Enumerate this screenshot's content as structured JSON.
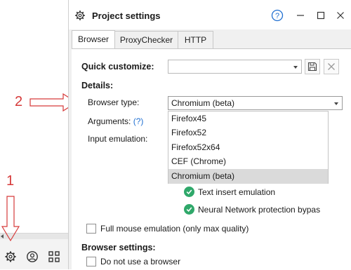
{
  "annotations": {
    "one": "1",
    "two": "2"
  },
  "dialog": {
    "title": "Project settings",
    "help_label": "?",
    "tabs": [
      {
        "label": "Browser",
        "active": true
      },
      {
        "label": "ProxyChecker",
        "active": false
      },
      {
        "label": "HTTP",
        "active": false
      }
    ],
    "quick_customize": {
      "label": "Quick customize:",
      "value": ""
    },
    "details_label": "Details:",
    "browser_type": {
      "label": "Browser type:",
      "value": "Chromium (beta)",
      "options": [
        "Firefox45",
        "Firefox52",
        "Firefox52x64",
        "CEF (Chrome)",
        "Chromium (beta)"
      ],
      "selected_index": 4
    },
    "arguments": {
      "label": "Arguments:",
      "help": "(?)"
    },
    "input_emulation": {
      "label": "Input emulation:"
    },
    "checks": [
      {
        "label": "Text insert emulation",
        "checked": true
      },
      {
        "label": "Neural Network protection bypas",
        "checked": true
      }
    ],
    "full_mouse": {
      "label": "Full mouse emulation (only max quality)",
      "checked": false
    },
    "browser_settings_label": "Browser settings:",
    "no_browser": {
      "label": "Do not use a browser",
      "checked": false
    }
  },
  "colors": {
    "accent_help": "#1f6fd1",
    "check_green": "#2fa86a",
    "annotation_red": "#d63a3a"
  },
  "host_icons": [
    "gear-icon",
    "user-icon",
    "grid-icon"
  ]
}
